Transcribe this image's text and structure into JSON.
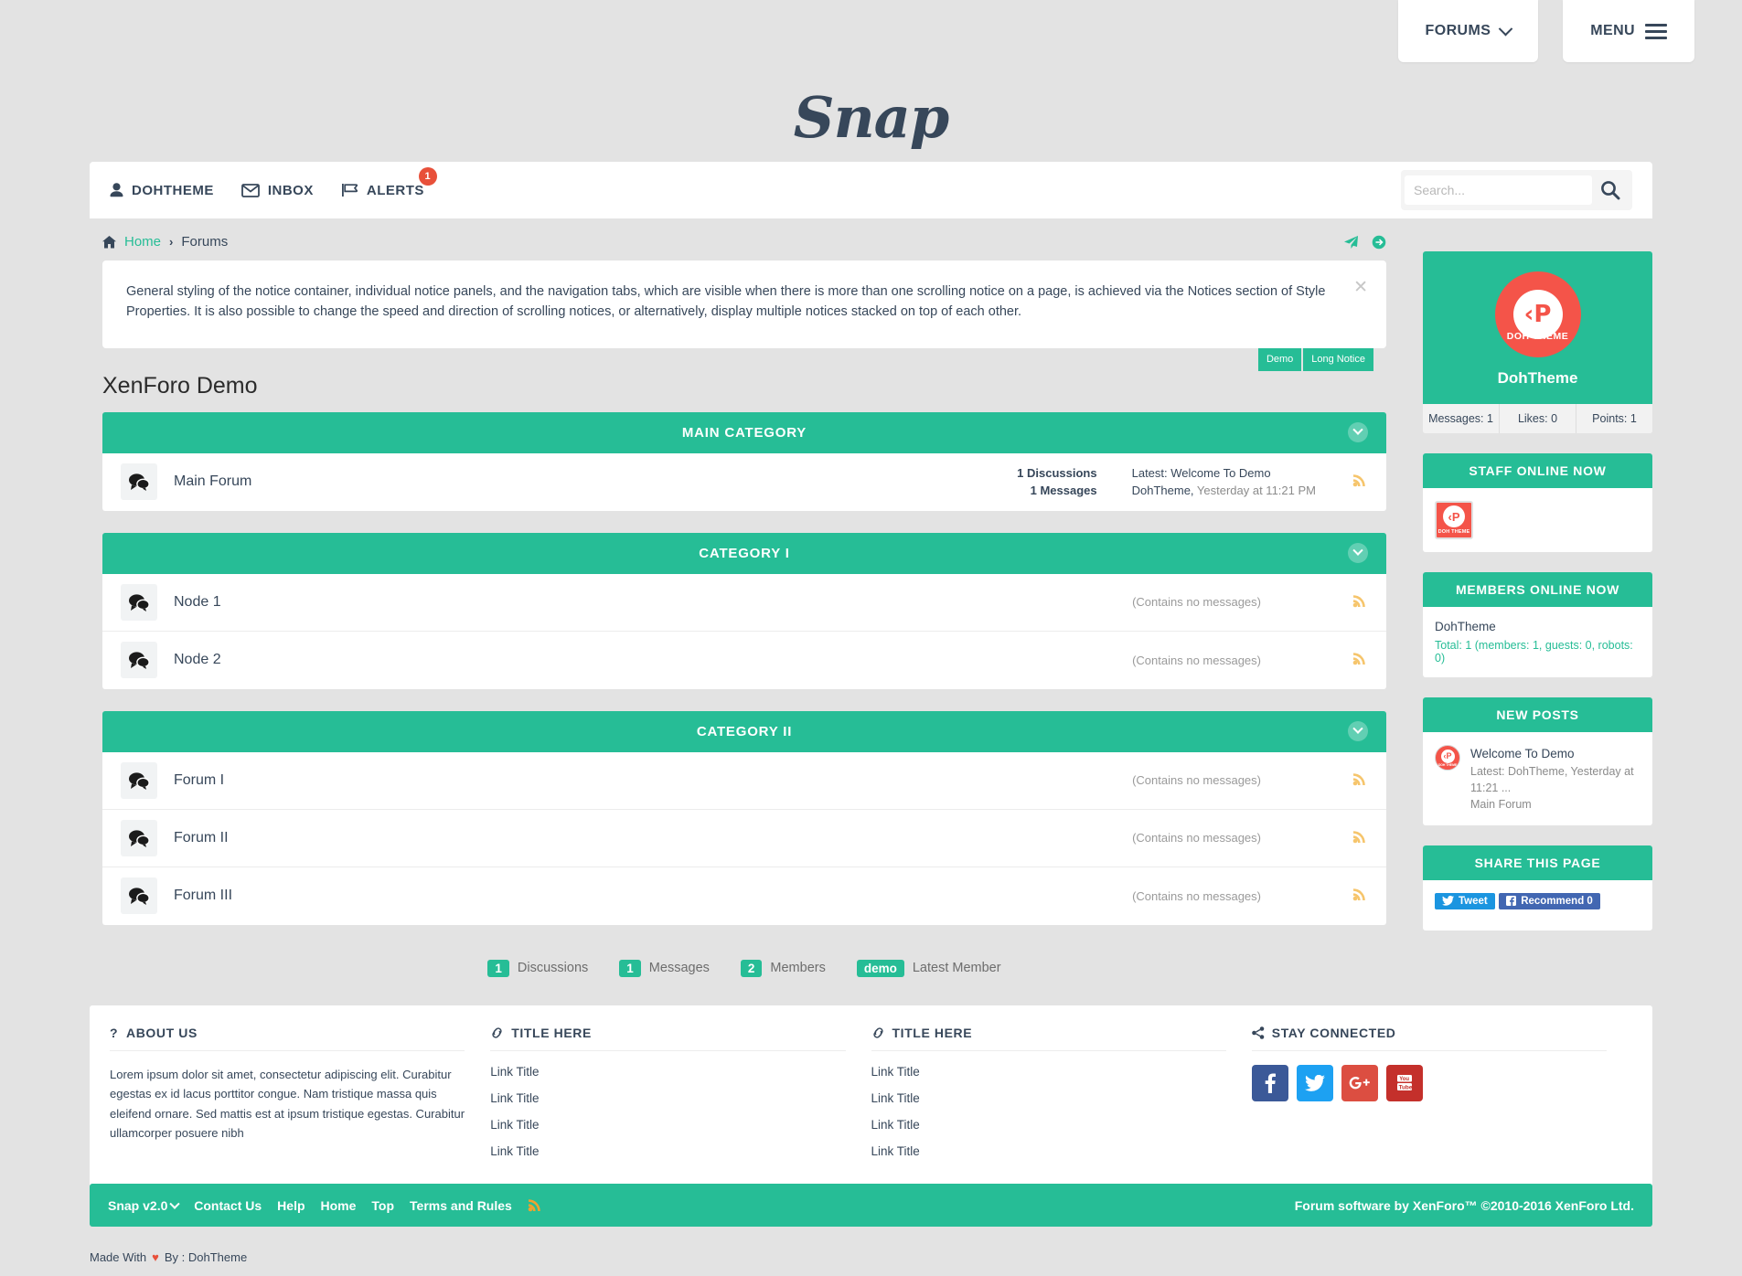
{
  "top_tabs": [
    {
      "label": "FORUMS",
      "icon": "chevron-down-icon"
    },
    {
      "label": "MENU",
      "icon": "hamburger-icon"
    }
  ],
  "logo": {
    "text": "Snap"
  },
  "navbar": {
    "items": [
      {
        "label": "DOHTHEME",
        "icon": "user-icon",
        "badge": ""
      },
      {
        "label": "INBOX",
        "icon": "envelope-icon",
        "badge": ""
      },
      {
        "label": "ALERTS",
        "icon": "flag-icon",
        "badge": "1"
      }
    ],
    "search": {
      "placeholder": "Search...",
      "value": "",
      "button_icon": "search-icon"
    }
  },
  "breadcrumb": {
    "home_icon": "home-icon",
    "home": "Home",
    "separator": "›",
    "current": "Forums"
  },
  "notice": {
    "text": "General styling of the notice container, individual notice panels, and the navigation tabs, which are visible when there is more than one scrolling notice on a page, is achieved via the Notices section of Style Properties. It is also possible to change the speed and direction of scrolling notices, or alternatively, display multiple notices stacked on top of each other.",
    "close_icon": "close-icon",
    "tabs": [
      "Demo",
      "Long Notice"
    ]
  },
  "page_title": "XenForo Demo",
  "categories": [
    {
      "title": "MAIN CATEGORY",
      "forums": [
        {
          "name": "Main Forum",
          "discussions": "1 Discussions",
          "messages": "1 Messages",
          "latest_title": "Latest: Welcome To Demo",
          "latest_meta_user": "DohTheme,",
          "latest_meta_time": " Yesterday at 11:21 PM",
          "empty": ""
        }
      ]
    },
    {
      "title": "CATEGORY I",
      "forums": [
        {
          "name": "Node 1",
          "empty": "(Contains no messages)"
        },
        {
          "name": "Node 2",
          "empty": "(Contains no messages)"
        }
      ]
    },
    {
      "title": "CATEGORY II",
      "forums": [
        {
          "name": "Forum I",
          "empty": "(Contains no messages)"
        },
        {
          "name": "Forum II",
          "empty": "(Contains no messages)"
        },
        {
          "name": "Forum III",
          "empty": "(Contains no messages)"
        }
      ]
    }
  ],
  "stats": [
    {
      "value": "1",
      "label": "Discussions"
    },
    {
      "value": "1",
      "label": "Messages"
    },
    {
      "value": "2",
      "label": "Members"
    },
    {
      "value": "demo",
      "label": "Latest Member"
    }
  ],
  "sidebar": {
    "visitor": {
      "name": "DohTheme",
      "avatar_letter": "‹P",
      "avatar_caption": "DOH THEME",
      "stats": [
        "Messages: 1",
        "Likes: 0",
        "Points: 1"
      ]
    },
    "staff_online": {
      "title": "STAFF ONLINE NOW",
      "members": [
        {
          "name": "DohTheme",
          "avatar_caption": "DOH THEME"
        }
      ]
    },
    "members_online": {
      "title": "MEMBERS ONLINE NOW",
      "member": "DohTheme",
      "total": "Total: 1 (members: 1, guests: 0, robots: 0)"
    },
    "new_posts": {
      "title": "NEW POSTS",
      "items": [
        {
          "title": "Welcome To Demo",
          "meta": "Latest: DohTheme, Yesterday at 11:21 ...",
          "forum": "Main Forum"
        }
      ]
    },
    "share": {
      "title": "SHARE THIS PAGE",
      "buttons": [
        {
          "label": "Tweet",
          "network": "twitter"
        },
        {
          "label": "Recommend 0",
          "network": "facebook"
        }
      ]
    }
  },
  "footer_columns": [
    {
      "title": "ABOUT US",
      "icon": "question-icon",
      "body": "Lorem ipsum dolor sit amet, consectetur adipiscing elit. Curabitur egestas ex id lacus porttitor congue. Nam tristique massa quis eleifend ornare. Sed mattis est at ipsum tristique egestas. Curabitur ullamcorper posuere nibh"
    },
    {
      "title": "TITLE HERE",
      "icon": "link-icon",
      "links": [
        "Link Title",
        "Link Title",
        "Link Title",
        "Link Title"
      ]
    },
    {
      "title": "TITLE HERE",
      "icon": "link-icon",
      "links": [
        "Link Title",
        "Link Title",
        "Link Title",
        "Link Title"
      ]
    },
    {
      "title": "STAY CONNECTED",
      "icon": "share-icon",
      "socials": [
        {
          "name": "facebook",
          "glyph": "f",
          "color": "#3b5998"
        },
        {
          "name": "twitter",
          "glyph": "t",
          "color": "#1da1f2"
        },
        {
          "name": "google-plus",
          "glyph": "G+",
          "color": "#dc4e41"
        },
        {
          "name": "youtube",
          "glyph": "You",
          "color": "#c4302b"
        }
      ]
    }
  ],
  "footer_bar": {
    "left": [
      "Snap v2.0",
      "Contact Us",
      "Help",
      "Home",
      "Top",
      "Terms and Rules"
    ],
    "rss_icon": "rss-icon",
    "right": "Forum software by XenForo™ ©2010-2016 XenForo Ltd."
  },
  "made_with": {
    "prefix": "Made With",
    "heart": "♥",
    "suffix": "By : DohTheme"
  },
  "colors": {
    "accent": "#26bd96",
    "dark": "#37475a",
    "badge": "#e8503a",
    "avatar": "#f45449",
    "rss": "#f6c56c"
  }
}
